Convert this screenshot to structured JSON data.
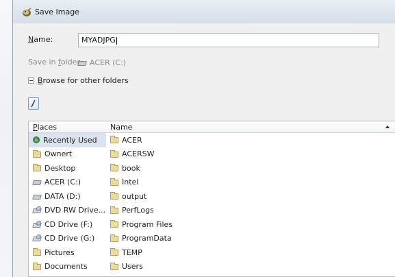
{
  "window": {
    "title": "Save Image"
  },
  "form": {
    "name_label_pre": "",
    "name_label_u": "N",
    "name_label_post": "ame:",
    "name_value": "MYADJPG",
    "folder_label_pre": "Save in ",
    "folder_label_u": "f",
    "folder_label_post": "older:",
    "folder_value": "ACER (C:)",
    "browse_pre": "",
    "browse_u": "B",
    "browse_post": "rowse for other folders"
  },
  "places": {
    "header_u": "P",
    "header_post": "laces",
    "items": [
      {
        "label": "Recently Used",
        "icon": "recent-icon"
      },
      {
        "label": "Ownert",
        "icon": "folder-icon"
      },
      {
        "label": "Desktop",
        "icon": "folder-icon"
      },
      {
        "label": "ACER (C:)",
        "icon": "hard-drive-icon"
      },
      {
        "label": "DATA (D:)",
        "icon": "hard-drive-icon"
      },
      {
        "label": "DVD RW Drive...",
        "icon": "dvd-drive-icon"
      },
      {
        "label": "CD Drive (F:)",
        "icon": "cd-drive-icon"
      },
      {
        "label": "CD Drive (G:)",
        "icon": "cd-drive-icon"
      },
      {
        "label": "Pictures",
        "icon": "folder-icon"
      },
      {
        "label": "Documents",
        "icon": "folder-icon"
      }
    ]
  },
  "files": {
    "header": "Name",
    "items": [
      {
        "label": "ACER"
      },
      {
        "label": "ACERSW"
      },
      {
        "label": "book"
      },
      {
        "label": "Intel"
      },
      {
        "label": "output"
      },
      {
        "label": "PerfLogs"
      },
      {
        "label": "Program Files"
      },
      {
        "label": "ProgramData"
      },
      {
        "label": "TEMP"
      },
      {
        "label": "Users"
      }
    ]
  }
}
